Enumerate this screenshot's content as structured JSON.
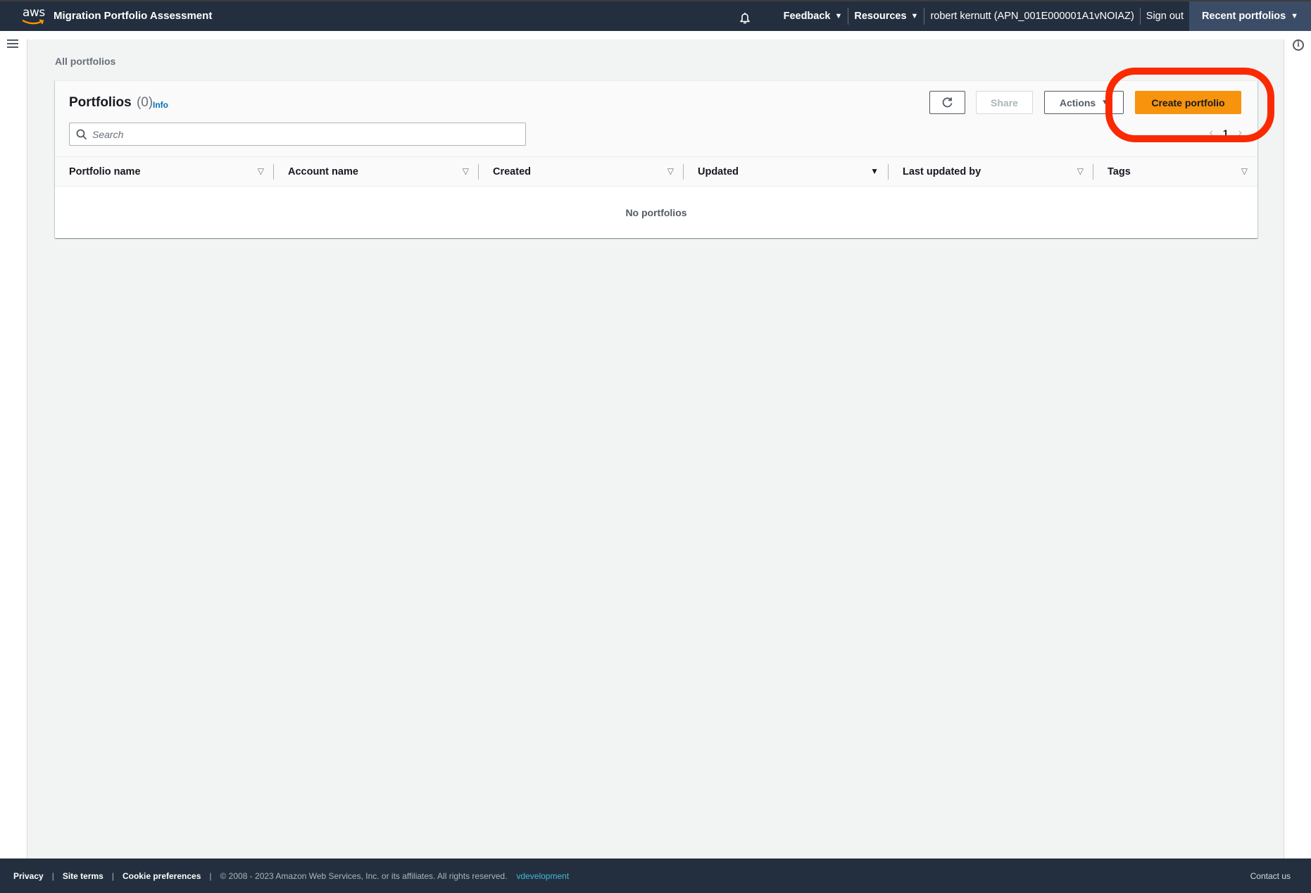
{
  "header": {
    "logo_text": "aws",
    "app_title": "Migration Portfolio Assessment",
    "notifications_icon": "bell-icon",
    "nav": [
      {
        "label": "Feedback",
        "has_caret": true
      },
      {
        "label": "Resources",
        "has_caret": true
      },
      {
        "label": "robert kernutt (APN_001E000001A1vNOIAZ)",
        "has_caret": false
      },
      {
        "label": "Sign out",
        "has_caret": false
      }
    ],
    "caret": "▼",
    "recent_portfolios_label": "Recent portfolios"
  },
  "side": {
    "menu_icon": "hamburger-icon",
    "help_icon": "info-icon",
    "help_glyph": "i"
  },
  "breadcrumb": "All portfolios",
  "portfolios": {
    "title": "Portfolios",
    "count": "(0)",
    "info_label": "Info",
    "search_placeholder": "Search",
    "search_value": "",
    "buttons": {
      "refresh_icon": "refresh-icon",
      "share": "Share",
      "actions": "Actions",
      "create": "Create portfolio"
    },
    "pagination": {
      "prev": "‹",
      "page": "1",
      "next": "›"
    },
    "columns": [
      {
        "label": "Portfolio name",
        "sort": "▽",
        "active": false
      },
      {
        "label": "Account name",
        "sort": "▽",
        "active": false
      },
      {
        "label": "Created",
        "sort": "▽",
        "active": false
      },
      {
        "label": "Updated",
        "sort": "▼",
        "active": true
      },
      {
        "label": "Last updated by",
        "sort": "▽",
        "active": false
      },
      {
        "label": "Tags",
        "sort": "▽",
        "active": false
      }
    ],
    "empty_message": "No portfolios"
  },
  "footer": {
    "links": [
      "Privacy",
      "Site terms",
      "Cookie preferences"
    ],
    "separator": "|",
    "copyright": "© 2008 - 2023 Amazon Web Services, Inc. or its affiliates. All rights reserved.",
    "environment": "vdevelopment",
    "contact": "Contact us"
  },
  "colors": {
    "header_bg": "#232f3e",
    "recent_bg": "#3b4d66",
    "primary_button": "#f7930c",
    "link": "#0073bb",
    "highlight": "#fa2a00"
  }
}
